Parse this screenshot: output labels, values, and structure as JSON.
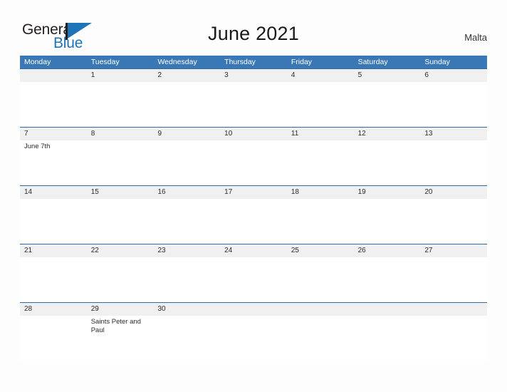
{
  "brand": {
    "name_part1": "General",
    "name_part2": "Blue",
    "flag_icon": "triangle-flag-icon",
    "accent_color": "#1f73b8"
  },
  "header": {
    "title": "June 2021",
    "country": "Malta"
  },
  "colors": {
    "header_blue": "#3a78b5",
    "row_band_gray": "#f0f0f0",
    "rule_blue": "#2f6ca5",
    "text": "#2b2b2b"
  },
  "calendar": {
    "month": "June",
    "year": "2021",
    "weekday_headers": [
      "Monday",
      "Tuesday",
      "Wednesday",
      "Thursday",
      "Friday",
      "Saturday",
      "Sunday"
    ],
    "weeks": [
      {
        "days": [
          {
            "number": "",
            "events": []
          },
          {
            "number": "1",
            "events": []
          },
          {
            "number": "2",
            "events": []
          },
          {
            "number": "3",
            "events": []
          },
          {
            "number": "4",
            "events": []
          },
          {
            "number": "5",
            "events": []
          },
          {
            "number": "6",
            "events": []
          }
        ]
      },
      {
        "days": [
          {
            "number": "7",
            "events": [
              "June 7th"
            ]
          },
          {
            "number": "8",
            "events": []
          },
          {
            "number": "9",
            "events": []
          },
          {
            "number": "10",
            "events": []
          },
          {
            "number": "11",
            "events": []
          },
          {
            "number": "12",
            "events": []
          },
          {
            "number": "13",
            "events": []
          }
        ]
      },
      {
        "days": [
          {
            "number": "14",
            "events": []
          },
          {
            "number": "15",
            "events": []
          },
          {
            "number": "16",
            "events": []
          },
          {
            "number": "17",
            "events": []
          },
          {
            "number": "18",
            "events": []
          },
          {
            "number": "19",
            "events": []
          },
          {
            "number": "20",
            "events": []
          }
        ]
      },
      {
        "days": [
          {
            "number": "21",
            "events": []
          },
          {
            "number": "22",
            "events": []
          },
          {
            "number": "23",
            "events": []
          },
          {
            "number": "24",
            "events": []
          },
          {
            "number": "25",
            "events": []
          },
          {
            "number": "26",
            "events": []
          },
          {
            "number": "27",
            "events": []
          }
        ]
      },
      {
        "days": [
          {
            "number": "28",
            "events": []
          },
          {
            "number": "29",
            "events": [
              "Saints Peter and Paul"
            ]
          },
          {
            "number": "30",
            "events": []
          },
          {
            "number": "",
            "events": []
          },
          {
            "number": "",
            "events": []
          },
          {
            "number": "",
            "events": []
          },
          {
            "number": "",
            "events": []
          }
        ]
      }
    ]
  }
}
